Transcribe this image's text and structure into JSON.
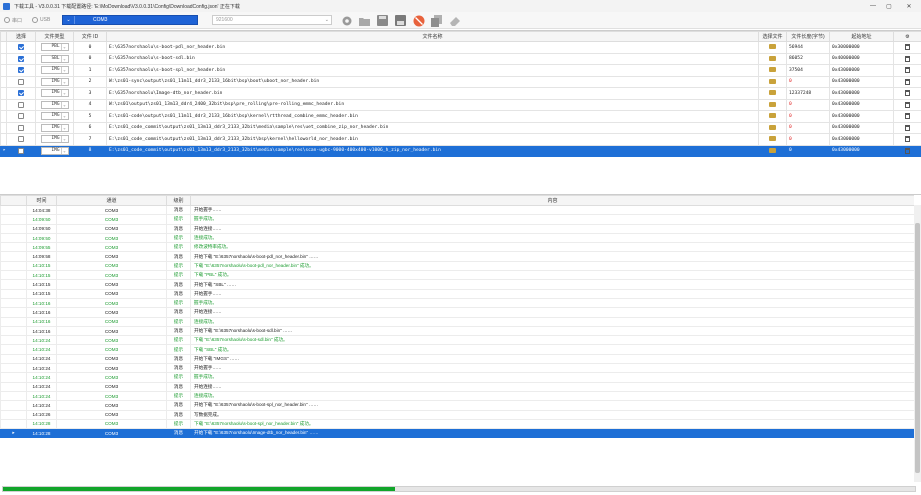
{
  "window": {
    "title": "下载工具 - V3.0.0.31  下载配置路径: 'E:\\MoDownload\\V3.0.0.31\\Config\\DownloadConfig.json'  正在下载"
  },
  "toolbar": {
    "port_label": "串口",
    "usb_label": "USB",
    "port_value": "COM3",
    "baud_value": "921600",
    "tools": [
      "gear-icon",
      "folder-open-icon",
      "save-icon",
      "save-as-icon",
      "stop-icon",
      "copy-icon",
      "eraser-icon"
    ]
  },
  "files_table": {
    "headers": [
      "选择",
      "文件类型",
      "文件 ID",
      "文件名称",
      "选择文件",
      "文件长度(字节)",
      "起始地址",
      ""
    ],
    "rows": [
      {
        "checked": true,
        "type": "PBL",
        "id": "0",
        "name": "E:\\6357norshaolu\\s-boot-pdl_nor_header.bin",
        "size": "56944",
        "addr": "0x30000000",
        "err": false
      },
      {
        "checked": true,
        "type": "SBL",
        "id": "0",
        "name": "E:\\6357norshaolu\\s-boot-sdl.bin",
        "size": "86052",
        "addr": "0x40000000",
        "err": false
      },
      {
        "checked": true,
        "type": "IMG",
        "id": "1",
        "name": "E:\\6357norshaolu\\s-boot-spl_nor_header.bin",
        "size": "37504",
        "addr": "0x43000000",
        "err": false
      },
      {
        "checked": false,
        "type": "IMG",
        "id": "2",
        "name": "W:\\zs01-sync\\output\\zs01_11m11_ddr3_2133_16bit\\bsp\\boot\\uboot_nor_header.bin",
        "size": "0",
        "addr": "0x43000000",
        "err": true
      },
      {
        "checked": true,
        "type": "IMG",
        "id": "3",
        "name": "E:\\6357norshaolu\\Image-dtb_nor_header.bin",
        "size": "12337248",
        "addr": "0x43000000",
        "err": false
      },
      {
        "checked": false,
        "type": "IMG",
        "id": "4",
        "name": "W:\\zs01\\output\\zs01_13m13_ddr4_2400_32bit\\bsp\\pre_rolling\\pre-rolling_emmc_header.bin",
        "size": "0",
        "addr": "0x43000000",
        "err": true
      },
      {
        "checked": false,
        "type": "IMG",
        "id": "5",
        "name": "E:\\zs01-code\\output\\zs01_11m11_ddr3_2133_16bit\\bsp\\kernel\\rtthread_combine_emmc_header.bin",
        "size": "0",
        "addr": "0x43000000",
        "err": true
      },
      {
        "checked": false,
        "type": "IMG",
        "id": "6",
        "name": "E:\\zs01_code_commit\\output\\zs01_13m13_ddr3_2133_32bit\\media\\sample\\res\\uet_combine_zip_nor_header.bin",
        "size": "0",
        "addr": "0x43000000",
        "err": true
      },
      {
        "checked": false,
        "type": "IMG",
        "id": "7",
        "name": "E:\\zs01_code_commit\\output\\zs01_13m13_ddr3_2133_32bit\\bsp\\kernel\\helloworld_nor_header.bin",
        "size": "0",
        "addr": "0x43000000",
        "err": true
      },
      {
        "checked": false,
        "type": "IMG",
        "id": "8",
        "name": "E:\\zs01_code_commit\\output\\zs01_13m13_ddr3_2133_32bit\\media\\sample\\res\\scan-ugbc-9000-400x400-v1006_h_zip_nor_header.bin",
        "size": "0",
        "addr": "0x43000000",
        "err": true,
        "selected": true
      }
    ]
  },
  "log_table": {
    "headers": [
      "时间",
      "通道",
      "级别",
      "内容"
    ],
    "rows": [
      {
        "time": "14:04:38",
        "ch": "COM3",
        "level": "消息",
        "msg": "开始握手……",
        "ok": false
      },
      {
        "time": "14:09:50",
        "ch": "COM3",
        "level": "提示",
        "msg": "握手成功。",
        "ok": true
      },
      {
        "time": "14:09:50",
        "ch": "COM3",
        "level": "消息",
        "msg": "开始连接……",
        "ok": false
      },
      {
        "time": "14:09:50",
        "ch": "COM3",
        "level": "提示",
        "msg": "连接成功。",
        "ok": true
      },
      {
        "time": "14:09:55",
        "ch": "COM3",
        "level": "提示",
        "msg": "修改波特率成功。",
        "ok": true
      },
      {
        "time": "14:09:58",
        "ch": "COM3",
        "level": "消息",
        "msg": "开始下载 \"E:\\6357norshaolu\\s-boot-pdl_nor_header.bin\" ……",
        "ok": false
      },
      {
        "time": "14:10:15",
        "ch": "COM3",
        "level": "提示",
        "msg": "下载 \"E:\\6357norshaolu\\s-boot-pdl_nor_header.bin\" 成功。",
        "ok": true
      },
      {
        "time": "14:10:15",
        "ch": "COM3",
        "level": "提示",
        "msg": "下载 \"PBL\" 成功。",
        "ok": true
      },
      {
        "time": "14:10:15",
        "ch": "COM3",
        "level": "消息",
        "msg": "开始下载 \"SBL\" ……",
        "ok": false
      },
      {
        "time": "14:10:15",
        "ch": "COM3",
        "level": "消息",
        "msg": "开始握手……",
        "ok": false
      },
      {
        "time": "14:10:16",
        "ch": "COM3",
        "level": "提示",
        "msg": "握手成功。",
        "ok": true
      },
      {
        "time": "14:10:16",
        "ch": "COM3",
        "level": "消息",
        "msg": "开始连接……",
        "ok": false
      },
      {
        "time": "14:10:16",
        "ch": "COM3",
        "level": "提示",
        "msg": "连接成功。",
        "ok": true
      },
      {
        "time": "14:10:16",
        "ch": "COM3",
        "level": "消息",
        "msg": "开始下载 \"E:\\6357norshaolu\\s-boot-sdl.bin\" ……",
        "ok": false
      },
      {
        "time": "14:10:24",
        "ch": "COM3",
        "level": "提示",
        "msg": "下载 \"E:\\6357norshaolu\\s-boot-sdl.bin\" 成功。",
        "ok": true
      },
      {
        "time": "14:10:24",
        "ch": "COM3",
        "level": "提示",
        "msg": "下载 \"SBL\" 成功。",
        "ok": true
      },
      {
        "time": "14:10:24",
        "ch": "COM3",
        "level": "消息",
        "msg": "开始下载 \"IMGS\" ……",
        "ok": false
      },
      {
        "time": "14:10:24",
        "ch": "COM3",
        "level": "消息",
        "msg": "开始握手……",
        "ok": false
      },
      {
        "time": "14:10:24",
        "ch": "COM3",
        "level": "提示",
        "msg": "握手成功。",
        "ok": true
      },
      {
        "time": "14:10:24",
        "ch": "COM3",
        "level": "消息",
        "msg": "开始连接……",
        "ok": false
      },
      {
        "time": "14:10:24",
        "ch": "COM3",
        "level": "提示",
        "msg": "连接成功。",
        "ok": true
      },
      {
        "time": "14:10:24",
        "ch": "COM3",
        "level": "消息",
        "msg": "开始下载 \"E:\\6357norshaolu\\s-boot-spl_nor_header.bin\" ……",
        "ok": false
      },
      {
        "time": "14:10:26",
        "ch": "COM3",
        "level": "消息",
        "msg": "写数据完成。",
        "ok": false
      },
      {
        "time": "14:10:28",
        "ch": "COM3",
        "level": "提示",
        "msg": "下载 \"E:\\6357norshaolu\\s-boot-spl_nor_header.bin\" 成功。",
        "ok": true
      },
      {
        "time": "14:10:28",
        "ch": "COM3",
        "level": "消息",
        "msg": "开始下载 \"E:\\6357norshaolu\\Image-dtb_nor_header.bin\" ……",
        "ok": false,
        "selected": true
      }
    ]
  },
  "progress": {
    "value": 0.43,
    "color": "#11a52a"
  },
  "colors": {
    "accent": "#1e6fd6",
    "ok_text": "#1a9b2e",
    "error_text": "#e02020"
  }
}
